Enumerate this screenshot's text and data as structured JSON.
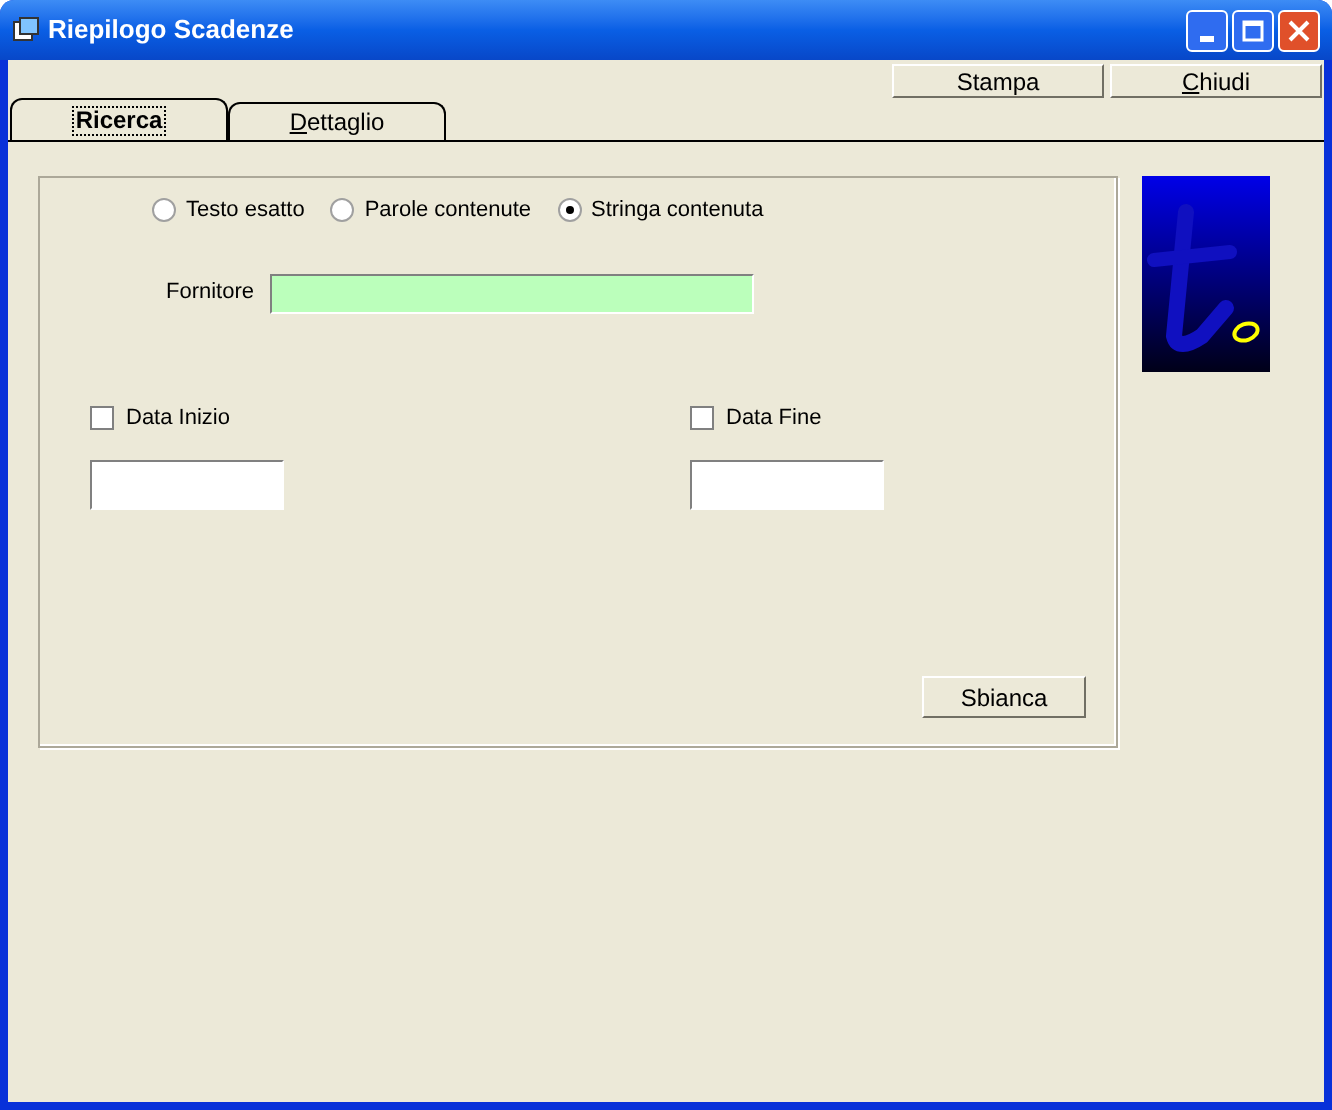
{
  "window": {
    "title": "Riepilogo Scadenze"
  },
  "toolbar_buttons": [
    {
      "label": "Stampa",
      "underlined_initial": false
    },
    {
      "label": "Chiudi",
      "underlined_initial": true
    }
  ],
  "tabs": [
    {
      "label": "Ricerca",
      "selected": true,
      "underlined_initial": false
    },
    {
      "label": "Dettaglio",
      "selected": false,
      "underlined_initial": true
    }
  ],
  "search_mode": [
    {
      "label": "Testo esatto",
      "selected": false
    },
    {
      "label": "Parole contenute",
      "selected": false
    },
    {
      "label": "Stringa contenuta",
      "selected": true
    }
  ],
  "supplier": {
    "label": "Fornitore"
  },
  "date_filters": [
    {
      "label": "Data Inizio",
      "checked": false
    },
    {
      "label": "Data Fine",
      "checked": false
    }
  ],
  "clear_button": {
    "label": "Sbianca"
  }
}
